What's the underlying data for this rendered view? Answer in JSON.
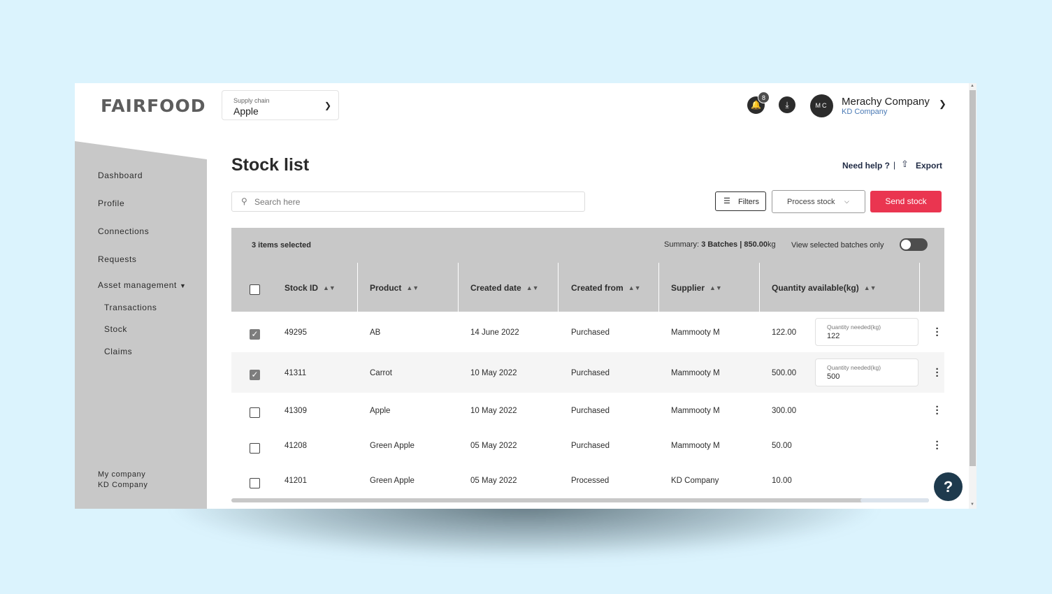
{
  "header": {
    "logo": "FAIRFOOD",
    "supply_chain_label": "Supply chain",
    "supply_chain_value": "Apple",
    "notification_count": "8",
    "user_initials": "MC",
    "user_name": "Merachy Company",
    "user_company": "KD Company"
  },
  "sidebar": {
    "items": [
      {
        "label": "Dashboard"
      },
      {
        "label": "Profile"
      },
      {
        "label": "Connections"
      },
      {
        "label": "Requests"
      },
      {
        "label": "Asset management"
      }
    ],
    "sub_items": [
      {
        "label": "Transactions"
      },
      {
        "label": "Stock"
      },
      {
        "label": "Claims"
      }
    ],
    "footer_label": "My company",
    "footer_company": "KD Company"
  },
  "main": {
    "title": "Stock list",
    "help_link": "Need help ?",
    "separator": "|",
    "export_label": "Export",
    "search_placeholder": "Search here",
    "filters_label": "Filters",
    "process_label": "Process stock",
    "send_label": "Send stock",
    "selected_text": "3 items selected",
    "summary_prefix": "Summary: ",
    "summary_batches": "3 Batches | 850.00",
    "summary_unit": "kg",
    "view_selected_label": "View selected batches only"
  },
  "table": {
    "columns": [
      "Stock ID",
      "Product",
      "Created date",
      "Created from",
      "Supplier",
      "Quantity available(kg)"
    ],
    "qty_needed_label": "Quantity needed(kg)",
    "rows": [
      {
        "id": "49295",
        "product": "AB",
        "date": "14 June 2022",
        "from": "Purchased",
        "supplier": "Mammooty M",
        "qty": "122.00",
        "checked": true,
        "needed": "122"
      },
      {
        "id": "41311",
        "product": "Carrot",
        "date": "10 May 2022",
        "from": "Purchased",
        "supplier": "Mammooty M",
        "qty": "500.00",
        "checked": true,
        "needed": "500"
      },
      {
        "id": "41309",
        "product": "Apple",
        "date": "10 May 2022",
        "from": "Purchased",
        "supplier": "Mammooty M",
        "qty": "300.00",
        "checked": false
      },
      {
        "id": "41208",
        "product": "Green Apple",
        "date": "05 May 2022",
        "from": "Purchased",
        "supplier": "Mammooty M",
        "qty": "50.00",
        "checked": false
      },
      {
        "id": "41201",
        "product": "Green Apple",
        "date": "05 May 2022",
        "from": "Processed",
        "supplier": "KD Company",
        "qty": "10.00",
        "checked": false
      }
    ]
  },
  "help_fab": "?",
  "colors": {
    "accent": "#ea3550",
    "sidebar": "#c8c8c8",
    "background": "#dbf3fd",
    "link": "#4a7ab5",
    "fab": "#1e3a4d"
  },
  "icons": [
    "chevron-down-icon",
    "bell-icon",
    "download-icon",
    "search-icon",
    "filter-icon",
    "export-icon",
    "sort-icon",
    "kebab-icon",
    "help-icon"
  ]
}
